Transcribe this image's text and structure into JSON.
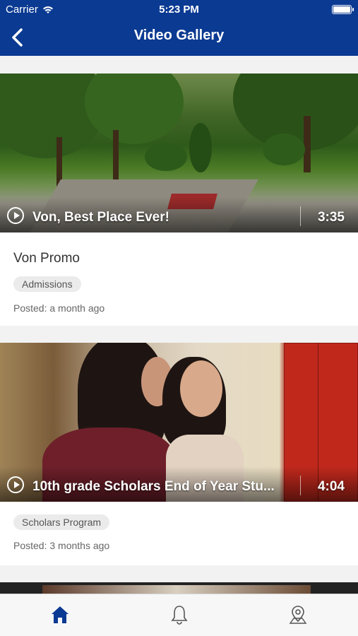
{
  "status_bar": {
    "carrier": "Carrier",
    "time": "5:23 PM"
  },
  "header": {
    "title": "Video Gallery",
    "accent_color": "#0b3a92"
  },
  "videos": [
    {
      "title": "Von, Best Place Ever!",
      "duration": "3:35",
      "name": "Von Promo",
      "tag": "Admissions",
      "posted": "Posted: a month ago"
    },
    {
      "title": "10th grade Scholars End of Year Stu...",
      "duration": "4:04",
      "tag": "Scholars Program",
      "posted": "Posted: 3 months ago"
    }
  ],
  "tabbar": {
    "items": [
      {
        "icon": "home-icon",
        "active": true
      },
      {
        "icon": "bell-icon",
        "active": false
      },
      {
        "icon": "location-pin-icon",
        "active": false
      }
    ]
  }
}
